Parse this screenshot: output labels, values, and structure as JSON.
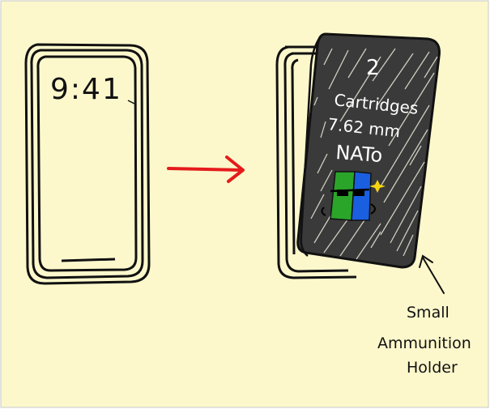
{
  "background_color": "#fcf8cc",
  "ink_color": "#111111",
  "arrow_color": "#e51b1b",
  "phone_screen": {
    "clock_text": "9:41"
  },
  "cover_case": {
    "color": "#3a3a3a",
    "text_lines": [
      "2",
      "Cartridges",
      "7.62 mm",
      "NATo"
    ],
    "sticker_colors": [
      "#2aa52a",
      "#1a5fe0"
    ],
    "sparkle_color": "#f5d40f"
  },
  "annotation": {
    "lines": [
      "Small",
      "Ammunition",
      "Holder"
    ]
  }
}
